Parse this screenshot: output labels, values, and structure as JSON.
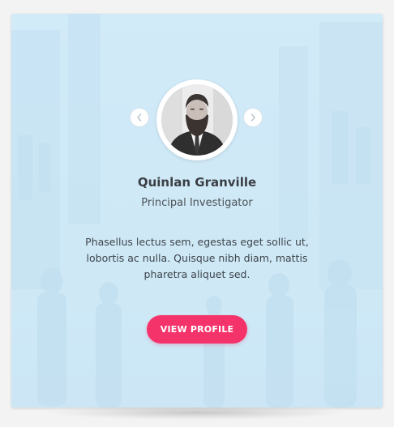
{
  "profile": {
    "name": "Quinlan Granville",
    "role": "Principal Investigator",
    "bio": "Phasellus lectus sem, egestas eget sollic ut, lobortis ac nulla. Quisque nibh diam, mattis pharetra aliquet sed.",
    "cta_label": "VIEW PROFILE"
  },
  "carousel": {
    "prev_icon": "chevron-left-icon",
    "next_icon": "chevron-right-icon"
  },
  "colors": {
    "page_background": "#f3f3f3",
    "card_tint": "#cfe8f5",
    "accent": "#f5336b",
    "name_text": "#3a3f44",
    "body_text": "#3e454b"
  }
}
